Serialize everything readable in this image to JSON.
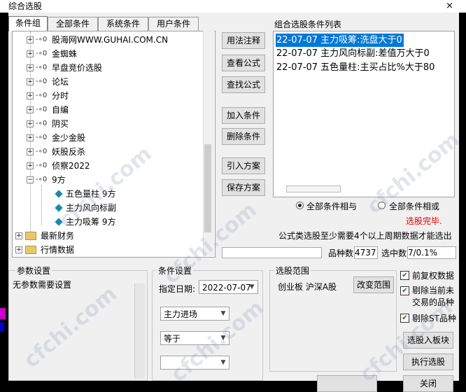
{
  "window": {
    "title": "综合选股",
    "close_glyph": "×"
  },
  "tabs": [
    "条件组",
    "全部条件",
    "系统条件",
    "用户条件"
  ],
  "tree": {
    "items": [
      {
        "label": "股海网WWW.GUHAI.COM.CN"
      },
      {
        "label": "金蜘蛛"
      },
      {
        "label": "早盘竞价选股"
      },
      {
        "label": "论坛"
      },
      {
        "label": "分时"
      },
      {
        "label": "自编"
      },
      {
        "label": "阴买"
      },
      {
        "label": "金少金股"
      },
      {
        "label": "妖股反杀"
      },
      {
        "label": "侦察2022"
      },
      {
        "label": "9方"
      }
    ],
    "children": [
      {
        "label": "五色量柱 9方"
      },
      {
        "label": "主力风向标副"
      },
      {
        "label": "主力吸筹 9方"
      }
    ],
    "folders": [
      {
        "label": "最新财务"
      },
      {
        "label": "行情数据"
      }
    ],
    "expander_plus": "+",
    "expander_minus": "−",
    "connector": "-∘0"
  },
  "buttons": {
    "usage": "用法注释",
    "view_formula": "查看公式",
    "find_formula": "查找公式",
    "add_condition": "加入条件",
    "delete_condition": "删除条件",
    "import_plan": "引入方案",
    "save_plan": "保存方案",
    "change_range": "改变范围",
    "select_to_board": "选股入板块",
    "execute": "执行选股",
    "close": "关闭"
  },
  "condition_list": {
    "title": "组合选股条件列表",
    "items": [
      "22-07-07 主力吸筹:洗盘大于0",
      "22-07-07 主力风向标副:差值万大于0",
      "22-07-07 五色量柱:主买占比%大于80"
    ]
  },
  "logic": {
    "all_and": "全部条件相与",
    "all_or": "全部条件相或",
    "selected": "all_and"
  },
  "status": {
    "done": "选股完毕.",
    "note": "公式类选股至少需要4个以上周期数据才能选出",
    "count_label": "品种数",
    "count_value": "4737",
    "selected_label": "选中数",
    "selected_value": "7/0.1%"
  },
  "params": {
    "title": "参数设置",
    "text": "无参数需要设置"
  },
  "condition_settings": {
    "title": "条件设置",
    "date_label": "指定日期:",
    "date_value": "2022-07-07",
    "select1": "主力进场",
    "select2": "等于",
    "select3": ""
  },
  "range": {
    "title": "选股范围",
    "value": "创业板 沪深A股"
  },
  "options": {
    "pre_adjust": "前复权数据",
    "exclude_untraded": "剔除当前未交易的品种",
    "exclude_st": "剔除ST品种"
  },
  "watermark": "cfchi.com",
  "colors": {
    "selection": "#0078d7",
    "status_red": "#e00000"
  }
}
